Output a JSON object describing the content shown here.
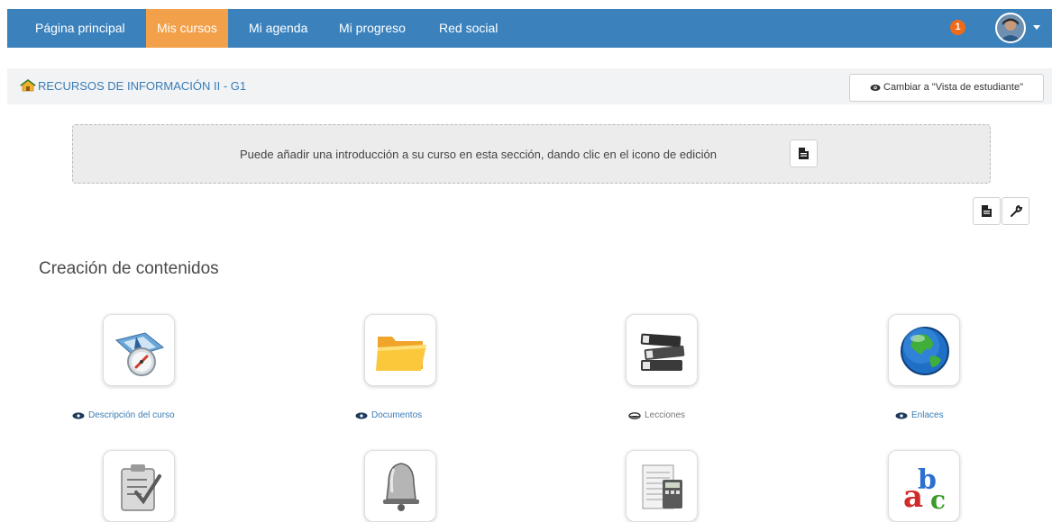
{
  "navbar": {
    "items": [
      {
        "label": "Página principal",
        "active": false
      },
      {
        "label": "Mis cursos",
        "active": true
      },
      {
        "label": "Mi agenda",
        "active": false
      },
      {
        "label": "Mi progreso",
        "active": false
      },
      {
        "label": "Red social",
        "active": false
      }
    ],
    "notification_count": "1",
    "colors": {
      "bar": "#3b82bd",
      "active": "#f3a04a",
      "badge": "#f06a18"
    }
  },
  "breadcrumb": {
    "course_title": "RECURSOS DE INFORMACIÓN II - G1",
    "home_icon": "home-icon"
  },
  "student_view_button": {
    "label": "Cambiar a \"Vista de estudiante\"",
    "icon": "eye-icon"
  },
  "intro": {
    "text": "Puede añadir una introducción a su curso en esta sección, dando clic en el icono de edición",
    "edit_icon": "document-edit-icon"
  },
  "section": {
    "title": "Creación de contenidos"
  },
  "tools": [
    {
      "label": "Descripción del curso",
      "icon": "course-description-icon",
      "visible": true
    },
    {
      "label": "Documentos",
      "icon": "folder-icon",
      "visible": true
    },
    {
      "label": "Lecciones",
      "icon": "books-icon",
      "visible": false
    },
    {
      "label": "Enlaces",
      "icon": "globe-icon",
      "visible": true
    },
    {
      "label": "",
      "icon": "tests-clipboard-icon",
      "visible": true
    },
    {
      "label": "",
      "icon": "bell-icon",
      "visible": true
    },
    {
      "label": "",
      "icon": "calculator-icon",
      "visible": true
    },
    {
      "label": "",
      "icon": "abc-glossary-icon",
      "visible": true
    }
  ]
}
